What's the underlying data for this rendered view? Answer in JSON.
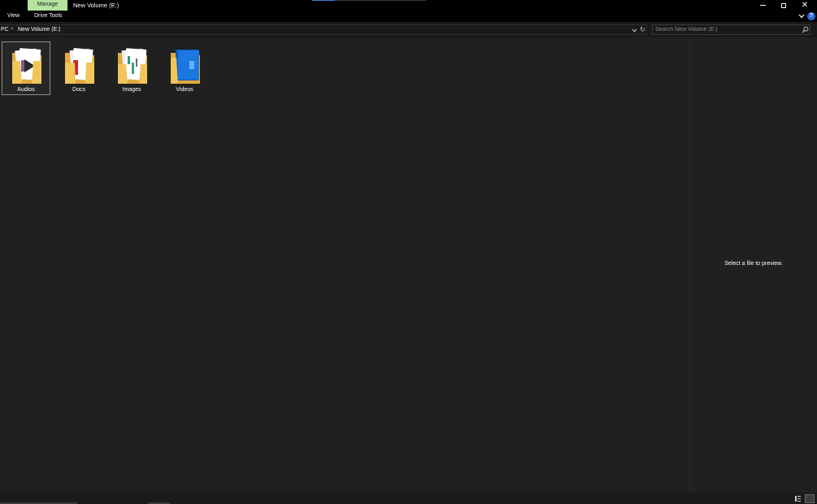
{
  "titlebar": {
    "manage_tab": "Manage",
    "window_title": "New Volume (E:)"
  },
  "ribbon": {
    "tabs": [
      "View",
      "Drive Tools"
    ]
  },
  "address_bar": {
    "crumbs": [
      "PC",
      "New Volume (E:)"
    ]
  },
  "search": {
    "placeholder": "Search New Volume (E:)"
  },
  "folders": [
    {
      "name": "Audios",
      "selected": true
    },
    {
      "name": "Docs",
      "selected": false
    },
    {
      "name": "Images",
      "selected": false
    },
    {
      "name": "Videos",
      "selected": false
    }
  ],
  "preview": {
    "message": "Select a file to preview."
  },
  "colors": {
    "manage_tab": "#b4e4a0",
    "accent_blue": "#2b6bd6",
    "background": "#202020",
    "folder_yellow": "#f0c55a"
  },
  "icons": [
    "minimize-icon",
    "maximize-icon",
    "close-icon",
    "chevron-down-icon",
    "help-icon",
    "refresh-icon",
    "search-icon",
    "details-view-icon",
    "large-icons-view-icon"
  ]
}
